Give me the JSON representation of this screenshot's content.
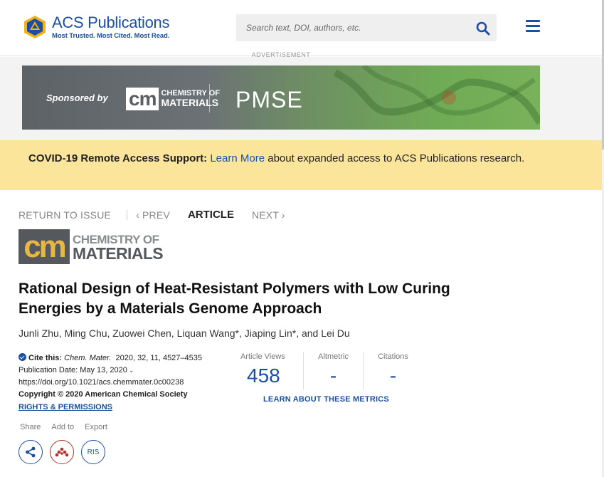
{
  "header": {
    "brand_name": "ACS Publications",
    "brand_tagline": "Most Trusted. Most Cited. Most Read.",
    "search_placeholder": "Search text, DOI, authors, etc.",
    "brand_color": "#1b4fa3"
  },
  "ad": {
    "label": "ADVERTISEMENT",
    "sponsored_text": "Sponsored by",
    "cm_box": "cm",
    "cm_words_1": "CHEMISTRY OF",
    "cm_words_2": "MATERIALS",
    "pmse": "PMSE"
  },
  "notice": {
    "bold_text": "COVID-19 Remote Access Support:",
    "link_text": "Learn More",
    "rest_text": " about expanded access to ACS Publications research.",
    "background": "#fbe59a"
  },
  "article_nav": {
    "return_label": "RETURN TO ISSUE",
    "prev_label": "‹ PREV",
    "article_label": "ARTICLE",
    "next_label": "NEXT ›"
  },
  "journal": {
    "cm": "cm",
    "line1": "CHEMISTRY OF",
    "line2": "MATERIALS"
  },
  "article": {
    "title": "Rational Design of Heat-Resistant Polymers with Low Curing Energies by a Materials Genome Approach",
    "authors": [
      "Junli Zhu",
      "Ming Chu",
      "Zuowei Chen",
      "Liquan Wang*",
      "Jiaping Lin*",
      "Lei Du"
    ]
  },
  "cite": {
    "cite_label": "Cite this:",
    "journal_abbr": "Chem. Mater.",
    "citation": "2020, 32, 11, 4527–4535",
    "pub_date": "Publication Date: May 13, 2020",
    "doi": "https://doi.org/10.1021/acs.chemmater.0c00238",
    "copyright": "Copyright © 2020 American Chemical Society",
    "rights": "RIGHTS & PERMISSIONS"
  },
  "metrics": {
    "views_label": "Article Views",
    "views_value": "458",
    "altmetric_label": "Altmetric",
    "altmetric_value": "-",
    "citations_label": "Citations",
    "citations_value": "-",
    "learn_label": "LEARN ABOUT THESE METRICS"
  },
  "tools": {
    "share_label": "Share",
    "addto_label": "Add to",
    "export_label": "Export",
    "ris_label": "RIS"
  }
}
